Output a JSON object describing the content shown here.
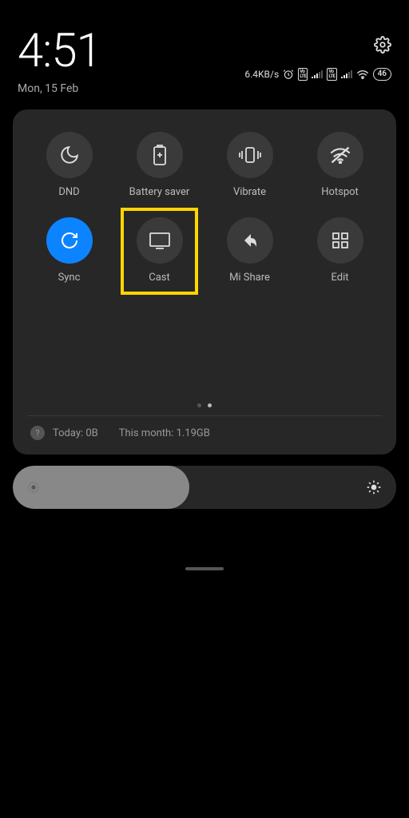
{
  "time": "4:51",
  "date": "Mon, 15 Feb",
  "status": {
    "speed": "6.4KB/s",
    "battery": "46"
  },
  "tiles": [
    {
      "label": "DND"
    },
    {
      "label": "Battery saver"
    },
    {
      "label": "Vibrate"
    },
    {
      "label": "Hotspot"
    },
    {
      "label": "Sync"
    },
    {
      "label": "Cast"
    },
    {
      "label": "Mi Share"
    },
    {
      "label": "Edit"
    }
  ],
  "data_usage": {
    "today": "Today: 0B",
    "month": "This month: 1.19GB"
  }
}
